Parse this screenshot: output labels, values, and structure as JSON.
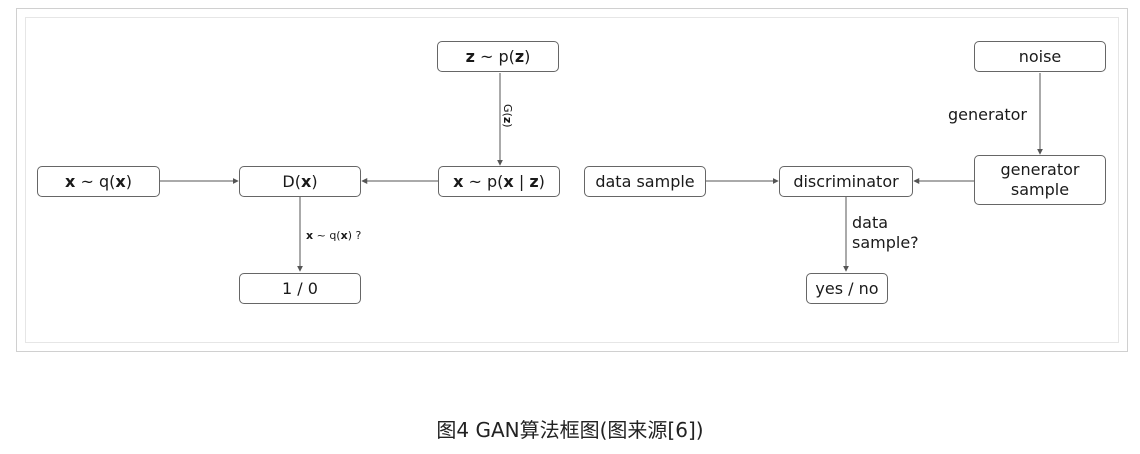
{
  "left": {
    "z_node": {
      "a": "z",
      "b": " ~ p(",
      "c": "z",
      "d": ")"
    },
    "gz_label": {
      "a": "G(",
      "b": "z",
      "c": ")"
    },
    "xq_node": {
      "a": "x",
      "b": " ~ q(",
      "c": "x",
      "d": ")"
    },
    "d_node": {
      "a": "D(",
      "b": "x",
      "c": ")"
    },
    "xpz_node": {
      "a": "x",
      "b": " ~ p(",
      "c": "x",
      "d": " | ",
      "e": "z",
      "f": ")"
    },
    "q_label": {
      "a": "x",
      "b": " ~ q(",
      "c": "x",
      "d": ") ?"
    },
    "out_node": "1 / 0"
  },
  "right": {
    "noise": "noise",
    "generator_label": "generator",
    "generator_sample": [
      "generator",
      "sample"
    ],
    "data_sample": "data sample",
    "discriminator": "discriminator",
    "question_label": [
      "data",
      "sample?"
    ],
    "answer": "yes / no"
  },
  "caption": "图4 GAN算法框图(图来源[6])",
  "colors": {
    "stroke": "#555555",
    "border": "#666666"
  }
}
